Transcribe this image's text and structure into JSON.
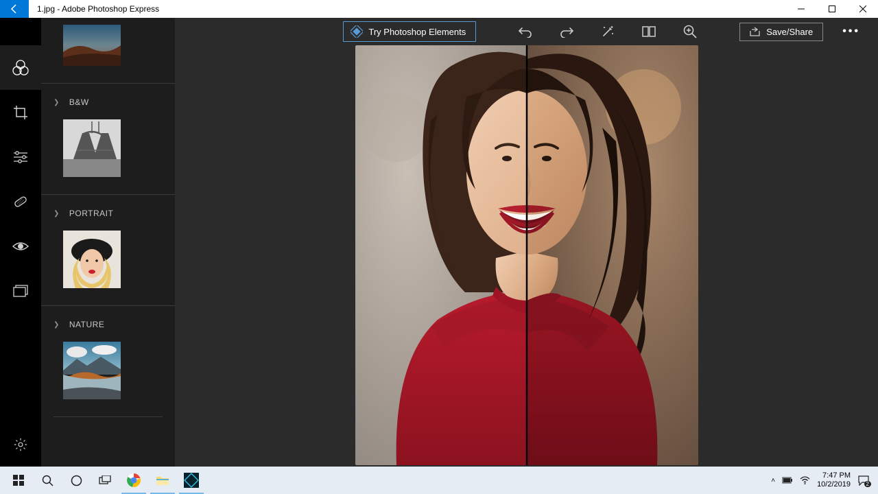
{
  "titlebar": {
    "filename": "1.jpg - Adobe Photoshop Express"
  },
  "toolbar": {
    "try_label": "Try Photoshop Elements",
    "save_label": "Save/Share"
  },
  "sidebar": {
    "categories": [
      {
        "label": "B&W"
      },
      {
        "label": "PORTRAIT"
      },
      {
        "label": "NATURE"
      }
    ]
  },
  "tool_rail": {
    "items": [
      "looks",
      "crop",
      "corrections",
      "spot-heal",
      "red-eye",
      "borders"
    ],
    "active": "looks"
  },
  "taskbar": {
    "time": "7:47 PM",
    "date": "10/2/2019",
    "notifications": "2"
  }
}
